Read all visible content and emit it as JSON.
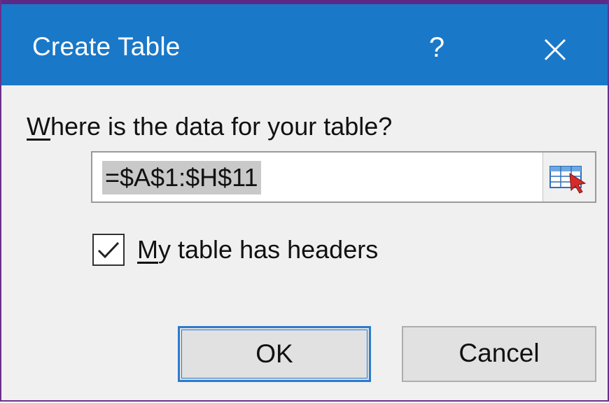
{
  "dialog": {
    "title": "Create Table",
    "help_label": "?",
    "prompt_prefix": "W",
    "prompt_rest": "here is the data for your table?",
    "range_value": "=$A$1:$H$11",
    "checkbox": {
      "checked": true,
      "label_prefix": "M",
      "label_rest": "y table has headers"
    },
    "ok_label": "OK",
    "cancel_label": "Cancel"
  },
  "colors": {
    "titlebar": "#1a78c8",
    "accent": "#2b7bd0",
    "window_border": "#6b2f8a"
  },
  "icons": [
    "help-icon",
    "close-icon",
    "range-collapse-icon",
    "check-icon"
  ]
}
